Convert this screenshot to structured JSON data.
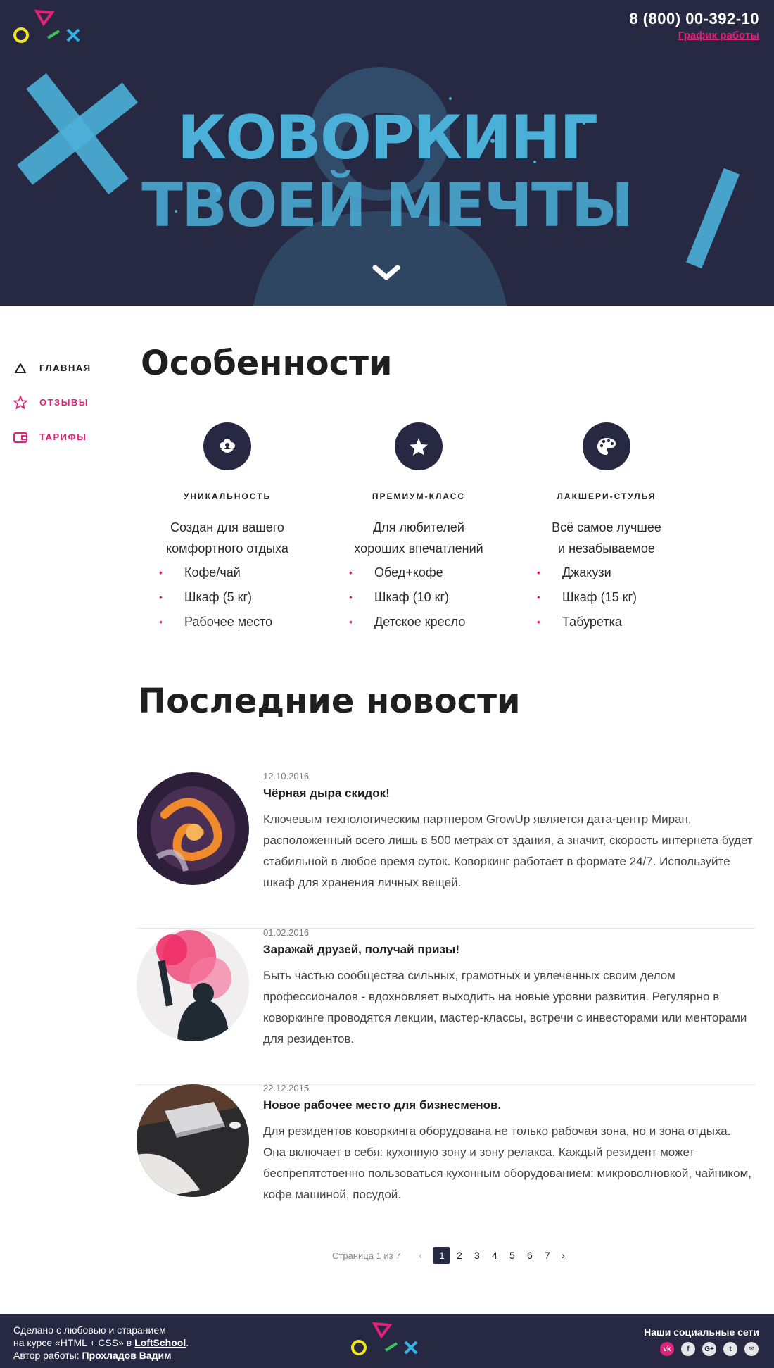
{
  "header": {
    "phone": "8 (800) 00-392-10",
    "schedule_link": "График работы",
    "hero_line1": "Коворкинг",
    "hero_line2": "твоей мечты"
  },
  "sidebar": {
    "items": [
      {
        "label": "Главная",
        "icon": "triangle-icon",
        "active": true
      },
      {
        "label": "Отзывы",
        "icon": "star-icon",
        "active": false
      },
      {
        "label": "Тарифы",
        "icon": "wallet-icon",
        "active": false
      }
    ]
  },
  "features": {
    "title": "Особенности",
    "items": [
      {
        "icon": "flower-icon",
        "title": "Уникальность",
        "desc_line1": "Создан для вашего",
        "desc_line2": "комфортного отдыха",
        "list": [
          "Кофе/чай",
          "Шкаф (5 кг)",
          "Рабочее место"
        ]
      },
      {
        "icon": "star-icon",
        "title": "Премиум-класс",
        "desc_line1": "Для любителей",
        "desc_line2": "хороших впечатлений",
        "list": [
          "Обед+кофе",
          "Шкаф (10 кг)",
          "Детское кресло"
        ]
      },
      {
        "icon": "palette-icon",
        "title": "Лакшери-стулья",
        "desc_line1": "Всё самое лучшее",
        "desc_line2": "и незабываемое",
        "list": [
          "Джакузи",
          "Шкаф (15 кг)",
          "Табуретка"
        ]
      }
    ]
  },
  "news": {
    "title": "Последние новости",
    "items": [
      {
        "date": "12.10.2016",
        "headline": "Чёрная дыра скидок!",
        "text": "Ключевым технологическим партнером GrowUp является дата-центр Миран, расположенный всего лишь в 500 метрах от здания, а значит, скорость интернета будет стабильной в любое время суток. Коворкинг работает в формате 24/7. Используйте шкаф для хранения личных вещей."
      },
      {
        "date": "01.02.2016",
        "headline": "Заражай друзей, получай призы!",
        "text": "Быть частью сообщества сильных, грамотных и увлеченных своим делом профессионалов - вдохновляет выходить на новые уровни развития. Регулярно в коворкинге проводятся лекции, мастер-классы, встречи с инвесторами или менторами для резидентов."
      },
      {
        "date": "22.12.2015",
        "headline": "Новое рабочее место для бизнесменов.",
        "text": "Для резидентов коворкинга оборудована не только рабочая зона, но и зона отдыха. Она включает в себя: кухонную зону и зону релакса. Каждый резидент может беспрепятственно пользоваться кухонным оборудованием: микроволновкой, чайником, кофе машиной, посудой."
      }
    ]
  },
  "pagination": {
    "info": "Страница 1 из 7",
    "prev": "‹",
    "next": "›",
    "pages": [
      "1",
      "2",
      "3",
      "4",
      "5",
      "6",
      "7"
    ],
    "current": "1"
  },
  "footer": {
    "credit_line1": "Сделано с любовью и старанием",
    "credit_line2_prefix": "на курсе «HTML + CSS» в ",
    "credit_line2_link": "LoftSchool",
    "credit_line2_suffix": ".",
    "credit_line3_prefix": "Автор работы: ",
    "credit_author": "Прохладов Вадим",
    "social_title": "Наши социальные сети",
    "socials": [
      {
        "icon": "vk-icon",
        "glyph": "vk"
      },
      {
        "icon": "facebook-icon",
        "glyph": "f"
      },
      {
        "icon": "google-plus-icon",
        "glyph": "G+"
      },
      {
        "icon": "twitter-icon",
        "glyph": "t"
      },
      {
        "icon": "mail-icon",
        "glyph": "✉"
      }
    ]
  },
  "colors": {
    "dark": "#272841",
    "accent_pink": "#e0237a",
    "hero_cyan": "#4bb0d8",
    "logo_yellow": "#f2e61c",
    "logo_green": "#3bc05a",
    "logo_blue": "#35b3e8"
  }
}
